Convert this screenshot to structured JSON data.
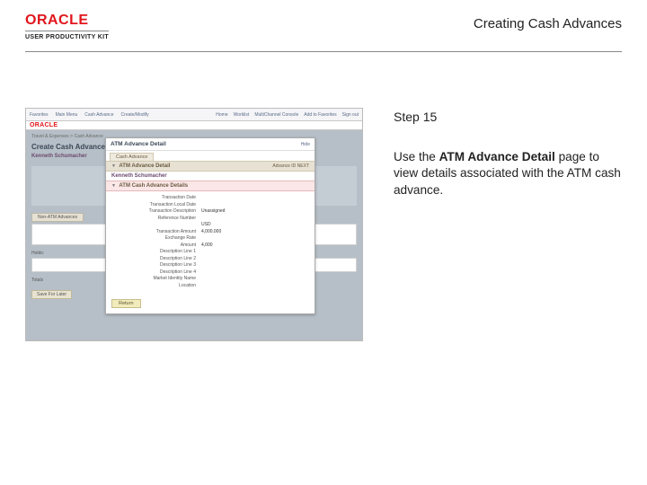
{
  "header": {
    "logo_text": "ORACLE",
    "logo_sub": "USER PRODUCTIVITY KIT",
    "doc_title": "Creating Cash Advances"
  },
  "instruction": {
    "step_label": "Step 15",
    "text_prefix": "Use the ",
    "text_bold": "ATM Advance Detail",
    "text_suffix": " page to view details associated with the ATM cash advance."
  },
  "app": {
    "brand": "ORACLE",
    "topnav": {
      "items": [
        "Favorites",
        "Main Menu",
        "Cash Advance",
        "Create/Modify"
      ],
      "right": [
        "Home",
        "Worklist",
        "MultiChannel Console",
        "Add to Favorites",
        "Sign out"
      ]
    },
    "breadcrumb": "Travel & Expenses > Cash Advance",
    "page_title": "Create Cash Advance",
    "user": "Kenneth Schumacher",
    "bg_tabs": [
      "Non-ATM Advances"
    ],
    "lower_label": "Totals",
    "buttons": [
      "Save For Later"
    ],
    "notes_label": "Holds:"
  },
  "modal": {
    "title": "ATM Advance Detail",
    "hide": "Hide",
    "tab": "Cash Advance",
    "section1": {
      "arrow": "▼",
      "label": "ATM Advance Detail",
      "right": "Advance ID   NEXT"
    },
    "user": "Kenneth Schumacher",
    "section2": {
      "arrow": "▼",
      "label": "ATM Cash Advance Details"
    },
    "fields": [
      {
        "label": "Transaction Date",
        "value": ""
      },
      {
        "label": "Transaction Local Date",
        "value": ""
      },
      {
        "label": "Transaction Description",
        "value": "Unassigned"
      },
      {
        "label": "Reference Number",
        "value": ""
      },
      {
        "label": "",
        "value": "USD"
      },
      {
        "label": "Transaction Amount",
        "value": "4,000.000"
      },
      {
        "label": "Exchange Rate",
        "value": ""
      },
      {
        "label": "Amount",
        "value": "4,000"
      },
      {
        "label": "Description Line 1",
        "value": ""
      },
      {
        "label": "Description Line 2",
        "value": ""
      },
      {
        "label": "Description Line 3",
        "value": ""
      },
      {
        "label": "Description Line 4",
        "value": ""
      },
      {
        "label": "Market Identity Name",
        "value": ""
      },
      {
        "label": "Location",
        "value": ""
      }
    ],
    "return_btn": "Return"
  }
}
